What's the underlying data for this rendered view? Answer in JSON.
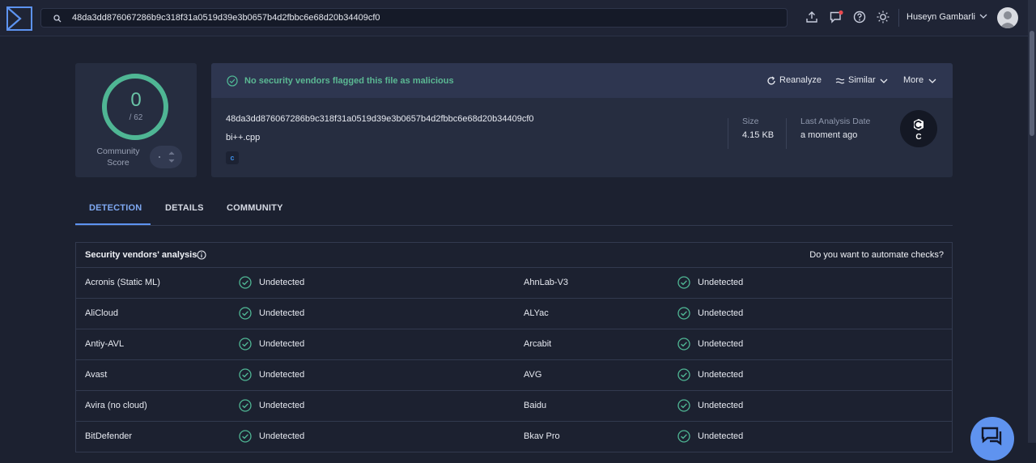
{
  "topbar": {
    "search_value": "48da3dd876067286b9c318f31a0519d39e3b0657b4d2fbbc6e68d20b34409cf0",
    "user_name": "Huseyn Gambarli",
    "icons": [
      "upload-icon",
      "notifications-icon",
      "help-icon",
      "theme-icon"
    ]
  },
  "score": {
    "value": "0",
    "total": "/ 62",
    "label_line1": "Community",
    "label_line2": "Score",
    "ring_color": "#4fb694"
  },
  "file": {
    "status": "No security vendors flagged this file as malicious",
    "actions": {
      "reanalyze": "Reanalyze",
      "similar": "Similar",
      "more": "More"
    },
    "hash": "48da3dd876067286b9c318f31a0519d39e3b0657b4d2fbbc6e68d20b34409cf0",
    "name": "bi++.cpp",
    "tag": "c",
    "size_label": "Size",
    "size_value": "4.15 KB",
    "date_label": "Last Analysis Date",
    "date_value": "a moment ago",
    "filetype_letter": "C"
  },
  "tabs": [
    "DETECTION",
    "DETAILS",
    "COMMUNITY"
  ],
  "analysis": {
    "title": "Security vendors' analysis",
    "automate": "Do you want to automate checks?",
    "rows": [
      {
        "left_vendor": "Acronis (Static ML)",
        "left_result": "Undetected",
        "right_vendor": "AhnLab-V3",
        "right_result": "Undetected"
      },
      {
        "left_vendor": "AliCloud",
        "left_result": "Undetected",
        "right_vendor": "ALYac",
        "right_result": "Undetected"
      },
      {
        "left_vendor": "Antiy-AVL",
        "left_result": "Undetected",
        "right_vendor": "Arcabit",
        "right_result": "Undetected"
      },
      {
        "left_vendor": "Avast",
        "left_result": "Undetected",
        "right_vendor": "AVG",
        "right_result": "Undetected"
      },
      {
        "left_vendor": "Avira (no cloud)",
        "left_result": "Undetected",
        "right_vendor": "Baidu",
        "right_result": "Undetected"
      },
      {
        "left_vendor": "BitDefender",
        "left_result": "Undetected",
        "right_vendor": "Bkav Pro",
        "right_result": "Undetected"
      }
    ]
  },
  "colors": {
    "accent": "#5d93f0",
    "success": "#4fb694",
    "background": "#1c2130"
  }
}
